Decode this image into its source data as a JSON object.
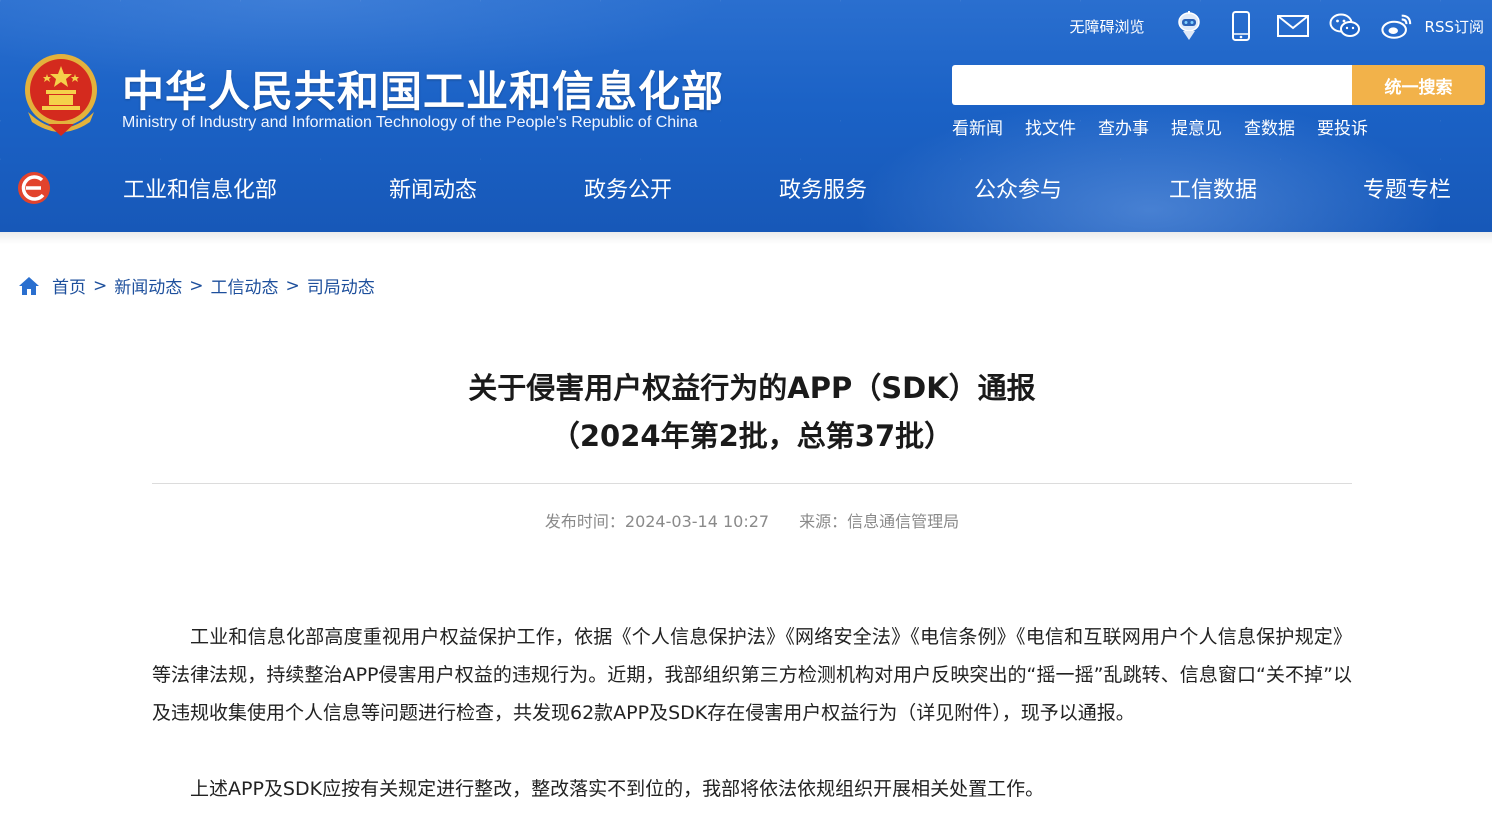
{
  "header": {
    "site_title": "中华人民共和国工业和信息化部",
    "site_subtitle": "Ministry of Industry and Information Technology of the People's Republic of China",
    "tools": {
      "accessibility": "无障碍浏览",
      "rss": "RSS订阅",
      "icons": [
        "robot-assistant-icon",
        "mobile-icon",
        "mail-icon",
        "wechat-icon",
        "weibo-icon",
        "rss-icon"
      ]
    },
    "search": {
      "placeholder": "",
      "button_label": "统一搜索"
    },
    "quick_links": [
      "看新闻",
      "找文件",
      "查办事",
      "提意见",
      "查数据",
      "要投诉"
    ],
    "nav": [
      "工业和信息化部",
      "新闻动态",
      "政务公开",
      "政务服务",
      "公众参与",
      "工信数据",
      "专题专栏"
    ],
    "colors": {
      "header_blue": "#1b62c6",
      "search_button": "#f2b24a"
    }
  },
  "breadcrumb": {
    "items": [
      "首页",
      "新闻动态",
      "工信动态",
      "司局动态"
    ],
    "separator": ">"
  },
  "article": {
    "title_line1": "关于侵害用户权益行为的APP（SDK）通报",
    "title_line2": "（2024年第2批，总第37批）",
    "publish_label": "发布时间：2024-03-14 10:27",
    "source_label": "来源：信息通信管理局",
    "paragraphs": [
      "工业和信息化部高度重视用户权益保护工作，依据《个人信息保护法》《网络安全法》《电信条例》《电信和互联网用户个人信息保护规定》等法律法规，持续整治APP侵害用户权益的违规行为。近期，我部组织第三方检测机构对用户反映突出的“摇一摇”乱跳转、信息窗口“关不掉”以及违规收集使用个人信息等问题进行检查，共发现62款APP及SDK存在侵害用户权益行为（详见附件），现予以通报。",
      "上述APP及SDK应按有关规定进行整改，整改落实不到位的，我部将依法依规组织开展相关处置工作。"
    ]
  }
}
